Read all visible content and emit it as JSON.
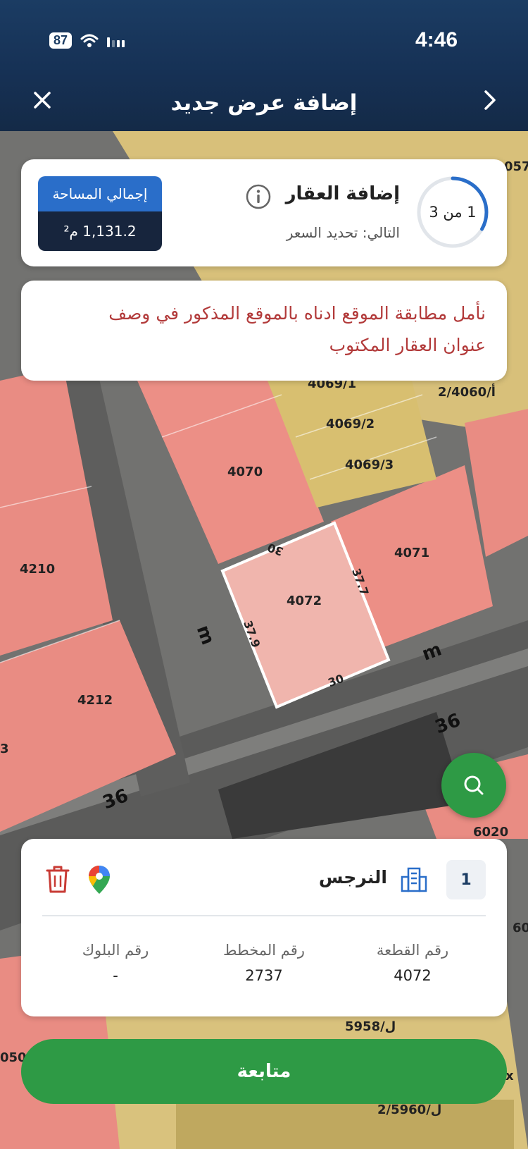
{
  "status_bar": {
    "time": "4:46",
    "battery": "87"
  },
  "header": {
    "title": "إضافة عرض جديد"
  },
  "step": {
    "progress_text": "1 من 3",
    "progress_fraction": 0.333,
    "title": "إضافة العقار",
    "next": "التالي: تحديد السعر",
    "area_label": "إجمالي المساحة",
    "area_value": "1,131.2 م²"
  },
  "note": {
    "line1": "نأمل مطابقة الموقع ادناه بالموقع المذكور في وصف",
    "line2": "عنوان العقار المكتوب"
  },
  "map": {
    "labels": {
      "p4069_1": "4069/1",
      "p4060": "2/أ/4060",
      "p4069_2": "4069/2",
      "p4069_3": "4069/3",
      "p4070": "4070",
      "p4071": "4071",
      "p4072": "4072",
      "p4210": "4210",
      "p4212": "4212",
      "p6020": "6020",
      "p5958": "ل/5958",
      "p5960": "2/ل/5960",
      "edge_top": "30",
      "edge_bottom": "30",
      "edge_left": "37.9",
      "edge_right": "37.7",
      "street_36_a": "36",
      "street_36_b": "36",
      "street_m_a": "m",
      "street_m_b": "m",
      "cut_top_right": "057",
      "cut_left_1": "3",
      "cut_left_2": "050",
      "cut_right_1": "60",
      "cut_right_2": "x"
    }
  },
  "parcel": {
    "index": "1",
    "district": "النرجس",
    "fields": [
      {
        "label": "رقم القطعة",
        "value": "4072"
      },
      {
        "label": "رقم المخطط",
        "value": "2737"
      },
      {
        "label": "رقم البلوك",
        "value": "-"
      }
    ]
  },
  "continue_label": "متابعة",
  "colors": {
    "primary_green": "#2e9a45",
    "navy": "#17253d",
    "blue": "#2a6ec9",
    "warning_red": "#b23a3a"
  }
}
